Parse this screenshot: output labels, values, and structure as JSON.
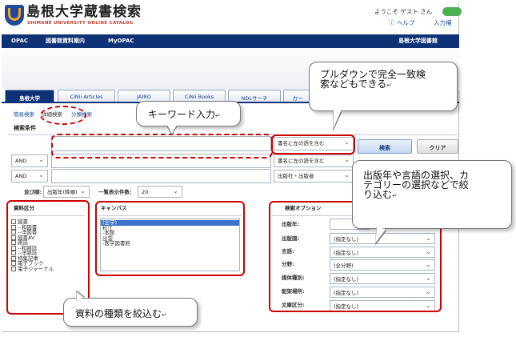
{
  "header": {
    "title": "島根大学蔵書検索",
    "subtitle": "SHIMANE UNIVERSITY ONLINE CATALOG",
    "welcome": "ようこそ ゲスト さん",
    "help": "ヘルプ",
    "input_support": "入力補"
  },
  "nav": {
    "items": [
      "OPAC",
      "図書館資料案内",
      "MyOPAC"
    ],
    "right": "島根大学図書館"
  },
  "tabs": [
    "島根大学",
    "CiNii Articles",
    "JAIRO",
    "CiNii Books",
    "NDLサーチ",
    "カー"
  ],
  "search": {
    "sublinks": [
      "簡易検索",
      "詳細検索",
      "分類検索"
    ],
    "condition_label": "検索条件",
    "title_mode": "書名に左の語を含む",
    "title_mode_2": "書名に左の語を含む",
    "publisher_mode": "出版社・出版者",
    "ops": [
      "AND",
      "AND"
    ],
    "search_button": "検索",
    "clear_button": "クリア",
    "sort_label": "並び順:",
    "sort_value": "出版年(降順)",
    "count_label": "一覧表示件数:",
    "count_value": "20"
  },
  "material": {
    "title": "資料区分",
    "items": [
      "図書",
      "--和図書",
      "--洋図書",
      "図書AV",
      "雑誌",
      "--和雑誌",
      "--洋雑誌",
      "特集記事",
      "電子ブック",
      "電子ジャーナル"
    ]
  },
  "campus": {
    "title": "キャンパス",
    "items": [
      "(全学)",
      "松江",
      "-本館",
      "出雲",
      "-医学図書館"
    ]
  },
  "options": {
    "title": "検索オプション",
    "rows": [
      {
        "label": "出版年:",
        "value": ""
      },
      {
        "label": "出版国:",
        "value": "(指定なし)"
      },
      {
        "label": "言語:",
        "value": "(指定なし)"
      },
      {
        "label": "分野:",
        "value": "(全分野)"
      },
      {
        "label": "媒体種別:",
        "value": "(指定なし)"
      },
      {
        "label": "配架場所:",
        "value": "(指定なし)"
      },
      {
        "label": "文庫区分:",
        "value": "(指定なし)"
      }
    ]
  },
  "callouts": {
    "keyword": "キーワード入力",
    "pulldown_line1": "プルダウンで完全一致検",
    "pulldown_line2": "索などもできる",
    "options_line1": "出版年や言語の選択、カ",
    "options_line2": "テゴリーの選択などで絞",
    "options_line3": "り込む",
    "material": "資料の種類を絞込む",
    "mark": "↵"
  },
  "colors": {
    "navy": "#0e3276",
    "annotation_red": "#cc0000",
    "link_blue": "#1a4f9a"
  }
}
